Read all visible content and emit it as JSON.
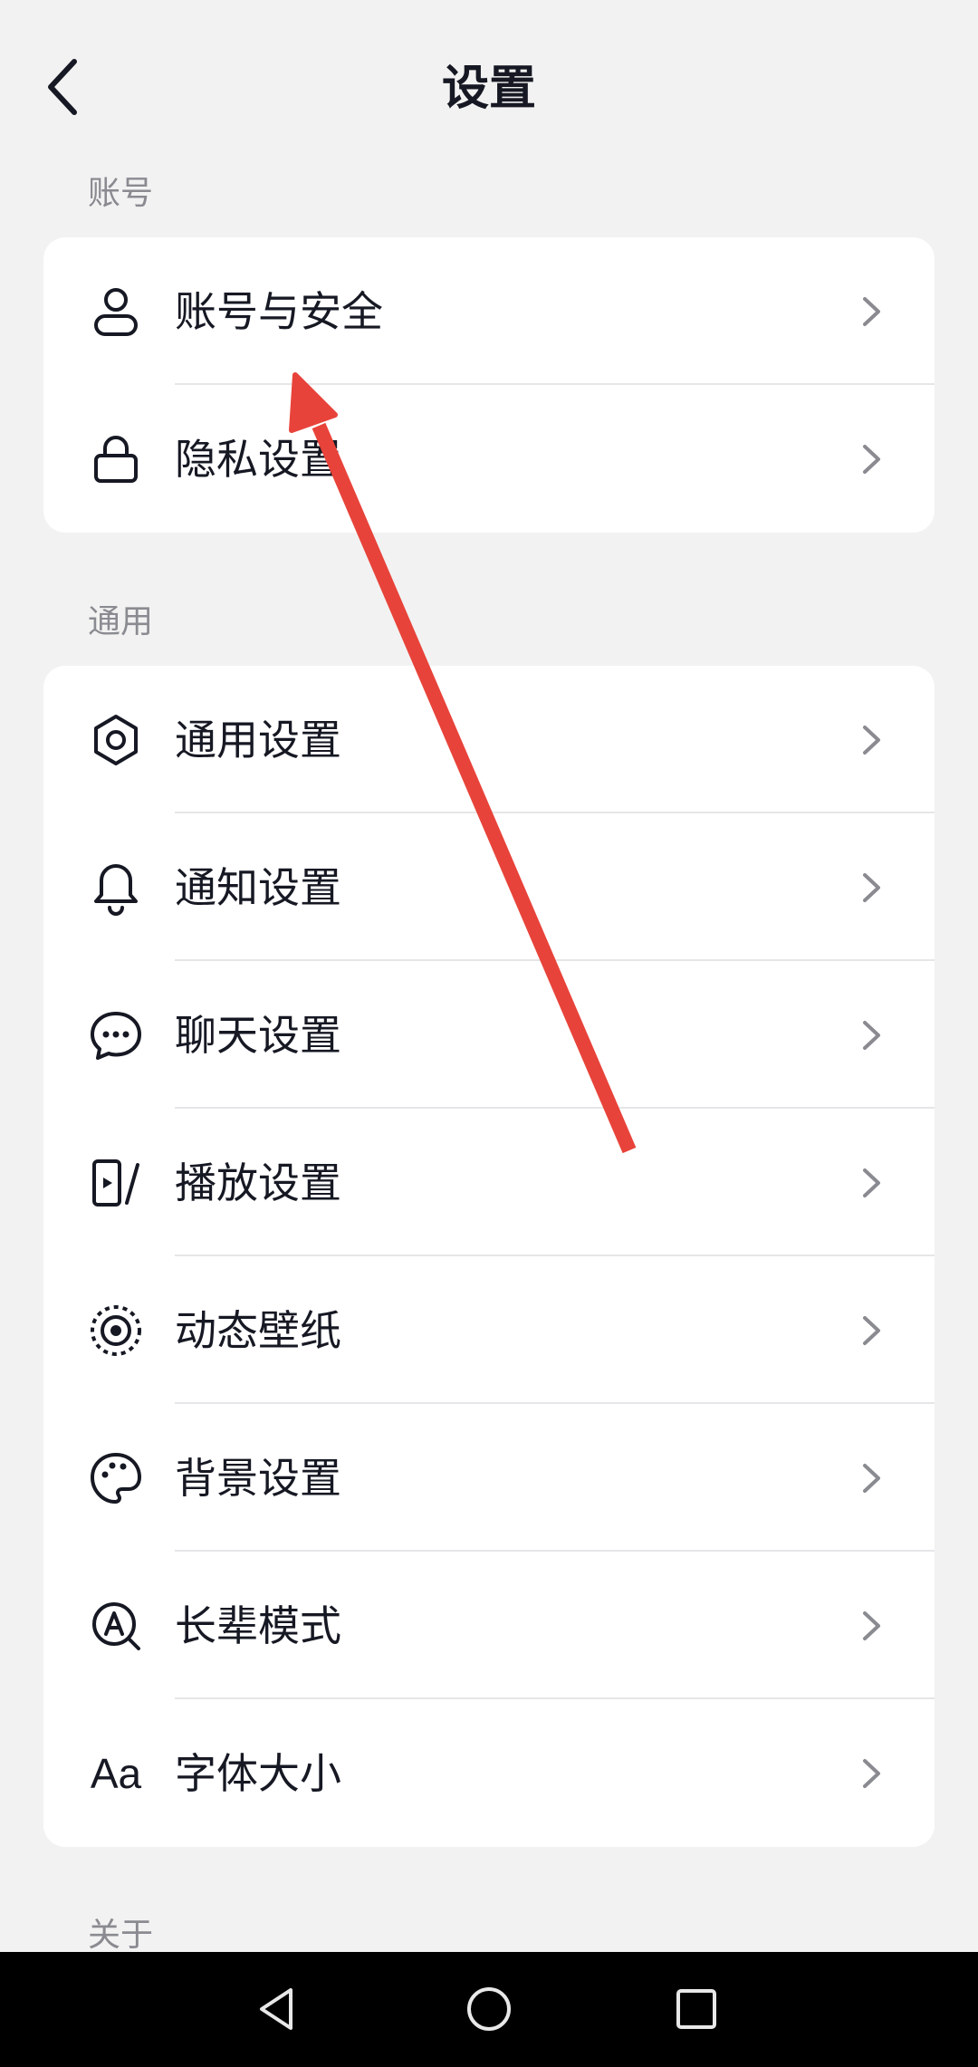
{
  "header": {
    "title": "设置"
  },
  "sections": {
    "account": {
      "label": "账号",
      "items": [
        {
          "label": "账号与安全",
          "icon": "user-icon"
        },
        {
          "label": "隐私设置",
          "icon": "lock-icon"
        }
      ]
    },
    "general": {
      "label": "通用",
      "items": [
        {
          "label": "通用设置",
          "icon": "gear-icon"
        },
        {
          "label": "通知设置",
          "icon": "bell-icon"
        },
        {
          "label": "聊天设置",
          "icon": "chat-bubble-icon"
        },
        {
          "label": "播放设置",
          "icon": "play-device-icon"
        },
        {
          "label": "动态壁纸",
          "icon": "wallpaper-icon"
        },
        {
          "label": "背景设置",
          "icon": "palette-icon"
        },
        {
          "label": "长辈模式",
          "icon": "elder-mode-icon"
        },
        {
          "label": "字体大小",
          "icon": "font-size-icon",
          "icon_text": "Aa"
        }
      ]
    },
    "about": {
      "label": "关于"
    }
  },
  "colors": {
    "accent_arrow": "#e8433a",
    "background": "#f2f2f2",
    "card": "#ffffff",
    "nav_bar": "#000000"
  },
  "navbar": {
    "buttons": [
      "back-triangle-icon",
      "home-circle-icon",
      "recents-square-icon"
    ]
  }
}
